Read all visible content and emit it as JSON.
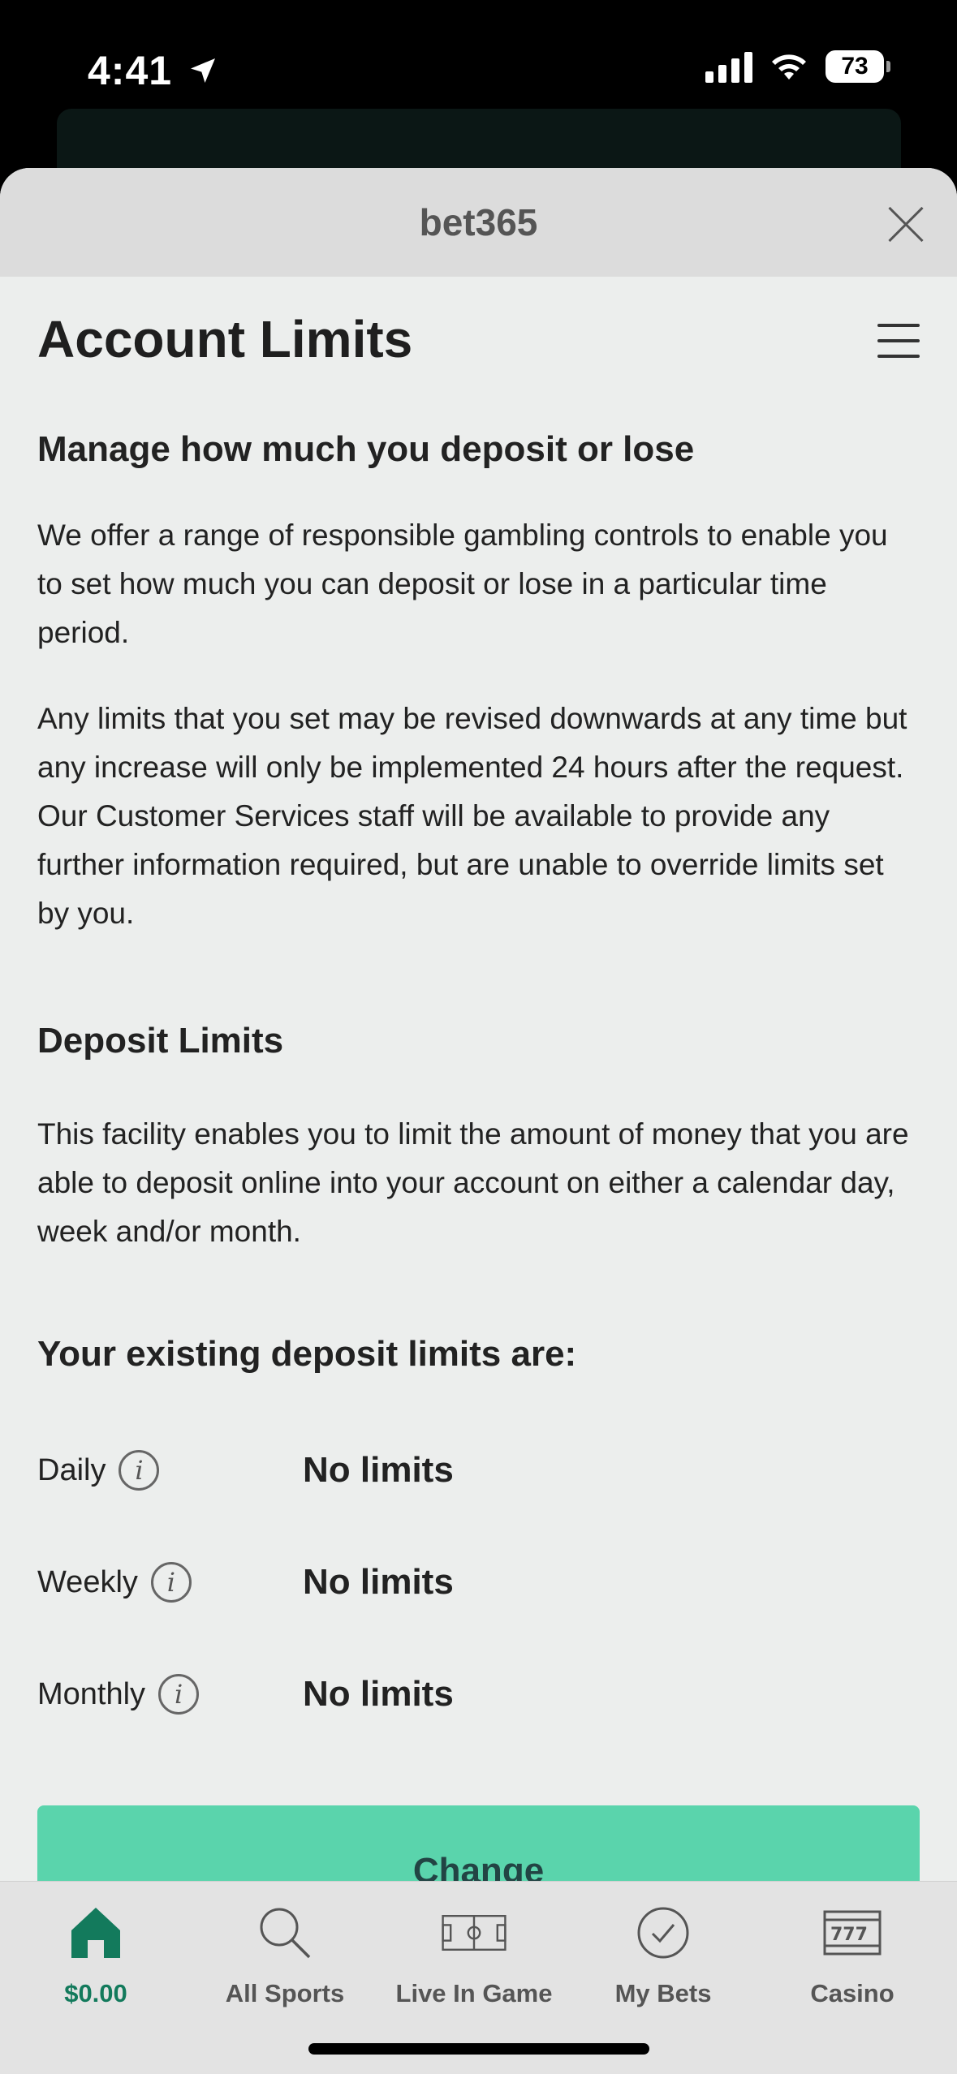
{
  "status_bar": {
    "time": "4:41",
    "battery": "73",
    "icons": [
      "location-arrow-icon",
      "cellular-signal-icon",
      "wifi-icon",
      "battery-icon"
    ]
  },
  "sheet": {
    "title": "bet365",
    "close_icon": "close-icon"
  },
  "page": {
    "title": "Account Limits",
    "menu_icon": "hamburger-menu-icon",
    "section1_heading": "Manage how much you deposit or lose",
    "section1_para1": "We offer a range of responsible gambling controls to enable you to set how much you can deposit or lose in a particular time period.",
    "section1_para2": "Any limits that you set may be revised downwards at any time but any increase will only be implemented 24 hours after the request. Our Customer Services staff will be available to provide any further information required, but are unable to override limits set by you.",
    "section2_heading": "Deposit Limits",
    "section2_para": "This facility enables you to limit the amount of money that you are able to deposit online into your account on either a calendar day, week and/or month.",
    "existing_heading": "Your existing deposit limits are:",
    "limits": [
      {
        "label": "Daily",
        "value": "No limits"
      },
      {
        "label": "Weekly",
        "value": "No limits"
      },
      {
        "label": "Monthly",
        "value": "No limits"
      }
    ],
    "change_button": "Change"
  },
  "bottom_nav": {
    "items": [
      {
        "label": "$0.00",
        "icon": "home-icon",
        "active": true
      },
      {
        "label": "All Sports",
        "icon": "search-icon",
        "active": false
      },
      {
        "label": "Live In Game",
        "icon": "pitch-icon",
        "active": false
      },
      {
        "label": "My Bets",
        "icon": "check-circle-icon",
        "active": false
      },
      {
        "label": "Casino",
        "icon": "slot-machine-icon",
        "active": false
      }
    ]
  },
  "colors": {
    "accent": "#137a5c",
    "button": "#5ad4ac",
    "sheet_bg": "#eceeed",
    "header_bg": "#dcdcdc"
  }
}
